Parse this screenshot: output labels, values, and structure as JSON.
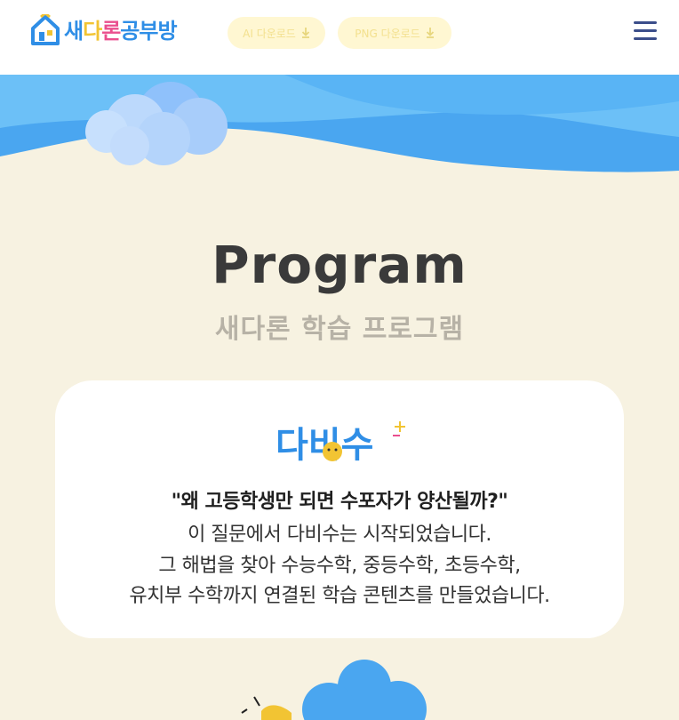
{
  "header": {
    "logo": {
      "part1": "새",
      "part2": "다",
      "part3": "론",
      "part4": "공부방"
    },
    "buttons": [
      {
        "label": "AI 다운로드",
        "icon": "download-icon"
      },
      {
        "label": "PNG 다운로드",
        "icon": "download-icon"
      }
    ],
    "menu_icon": "hamburger-menu-icon"
  },
  "section": {
    "title": "Program",
    "subtitle": "새다론 학습 프로그램"
  },
  "card": {
    "logo_text": "다비수",
    "quote": "\"왜 고등학생만 되면 수포자가 양산될까?\"",
    "lines": [
      "이 질문에서 다비수는 시작되었습니다.",
      "그 해법을 찾아 수능수학, 중등수학, 초등수학,",
      "유치부 수학까지 연결된 학습 콘텐츠를 만들었습니다."
    ]
  },
  "colors": {
    "background": "#f7f2e1",
    "wave_blue": "#4aa6f0",
    "wave_light": "#6cc0f7",
    "brand_blue": "#2f8ee6",
    "title": "#3a3a3a",
    "subtitle": "#b7b2a6"
  }
}
